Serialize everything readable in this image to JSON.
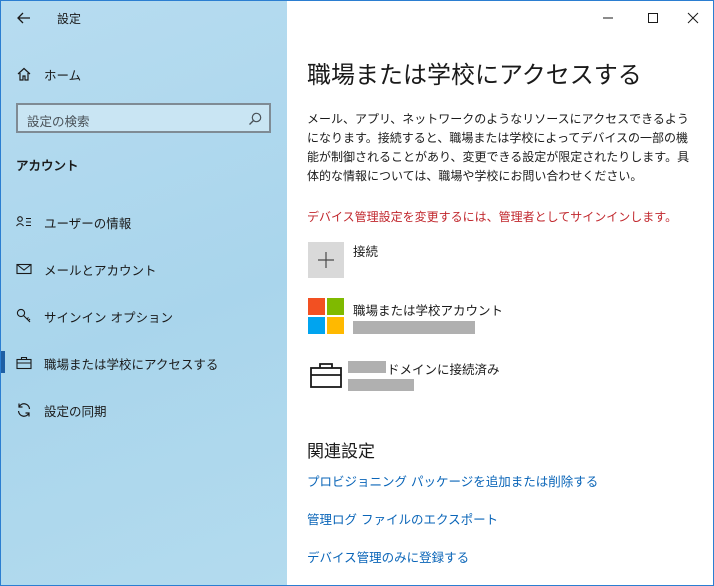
{
  "window": {
    "title": "設定"
  },
  "sidebar": {
    "home_label": "ホーム",
    "search_placeholder": "設定の検索",
    "section_title": "アカウント",
    "items": [
      {
        "label": "ユーザーの情報",
        "icon": "user-info-icon"
      },
      {
        "label": "メールとアカウント",
        "icon": "mail-icon"
      },
      {
        "label": "サインイン オプション",
        "icon": "key-icon"
      },
      {
        "label": "職場または学校にアクセスする",
        "icon": "briefcase-icon",
        "selected": true
      },
      {
        "label": "設定の同期",
        "icon": "sync-icon"
      }
    ]
  },
  "main": {
    "title": "職場または学校にアクセスする",
    "description": "メール、アプリ、ネットワークのようなリソースにアクセスできるようになります。接続すると、職場または学校によってデバイスの一部の機能が制御されることがあり、変更できる設定が限定されたりします。具体的な情報については、職場や学校にお問い合わせください。",
    "warning": "デバイス管理設定を変更するには、管理者としてサインインします。",
    "connect_label": "接続",
    "accounts": [
      {
        "title": "職場または学校アカウント",
        "icon": "microsoft-logo"
      },
      {
        "title": "ドメインに接続済み",
        "icon": "briefcase-icon"
      }
    ],
    "related": {
      "title": "関連設定",
      "links": [
        "プロビジョニング パッケージを追加または削除する",
        "管理ログ ファイルのエクスポート",
        "デバイス管理のみに登録する"
      ]
    }
  },
  "colors": {
    "sidebar_bg": "#b3dbee",
    "accent": "#0a65b8",
    "warning": "#c1272d",
    "active_indicator": "#1e5fa5"
  }
}
